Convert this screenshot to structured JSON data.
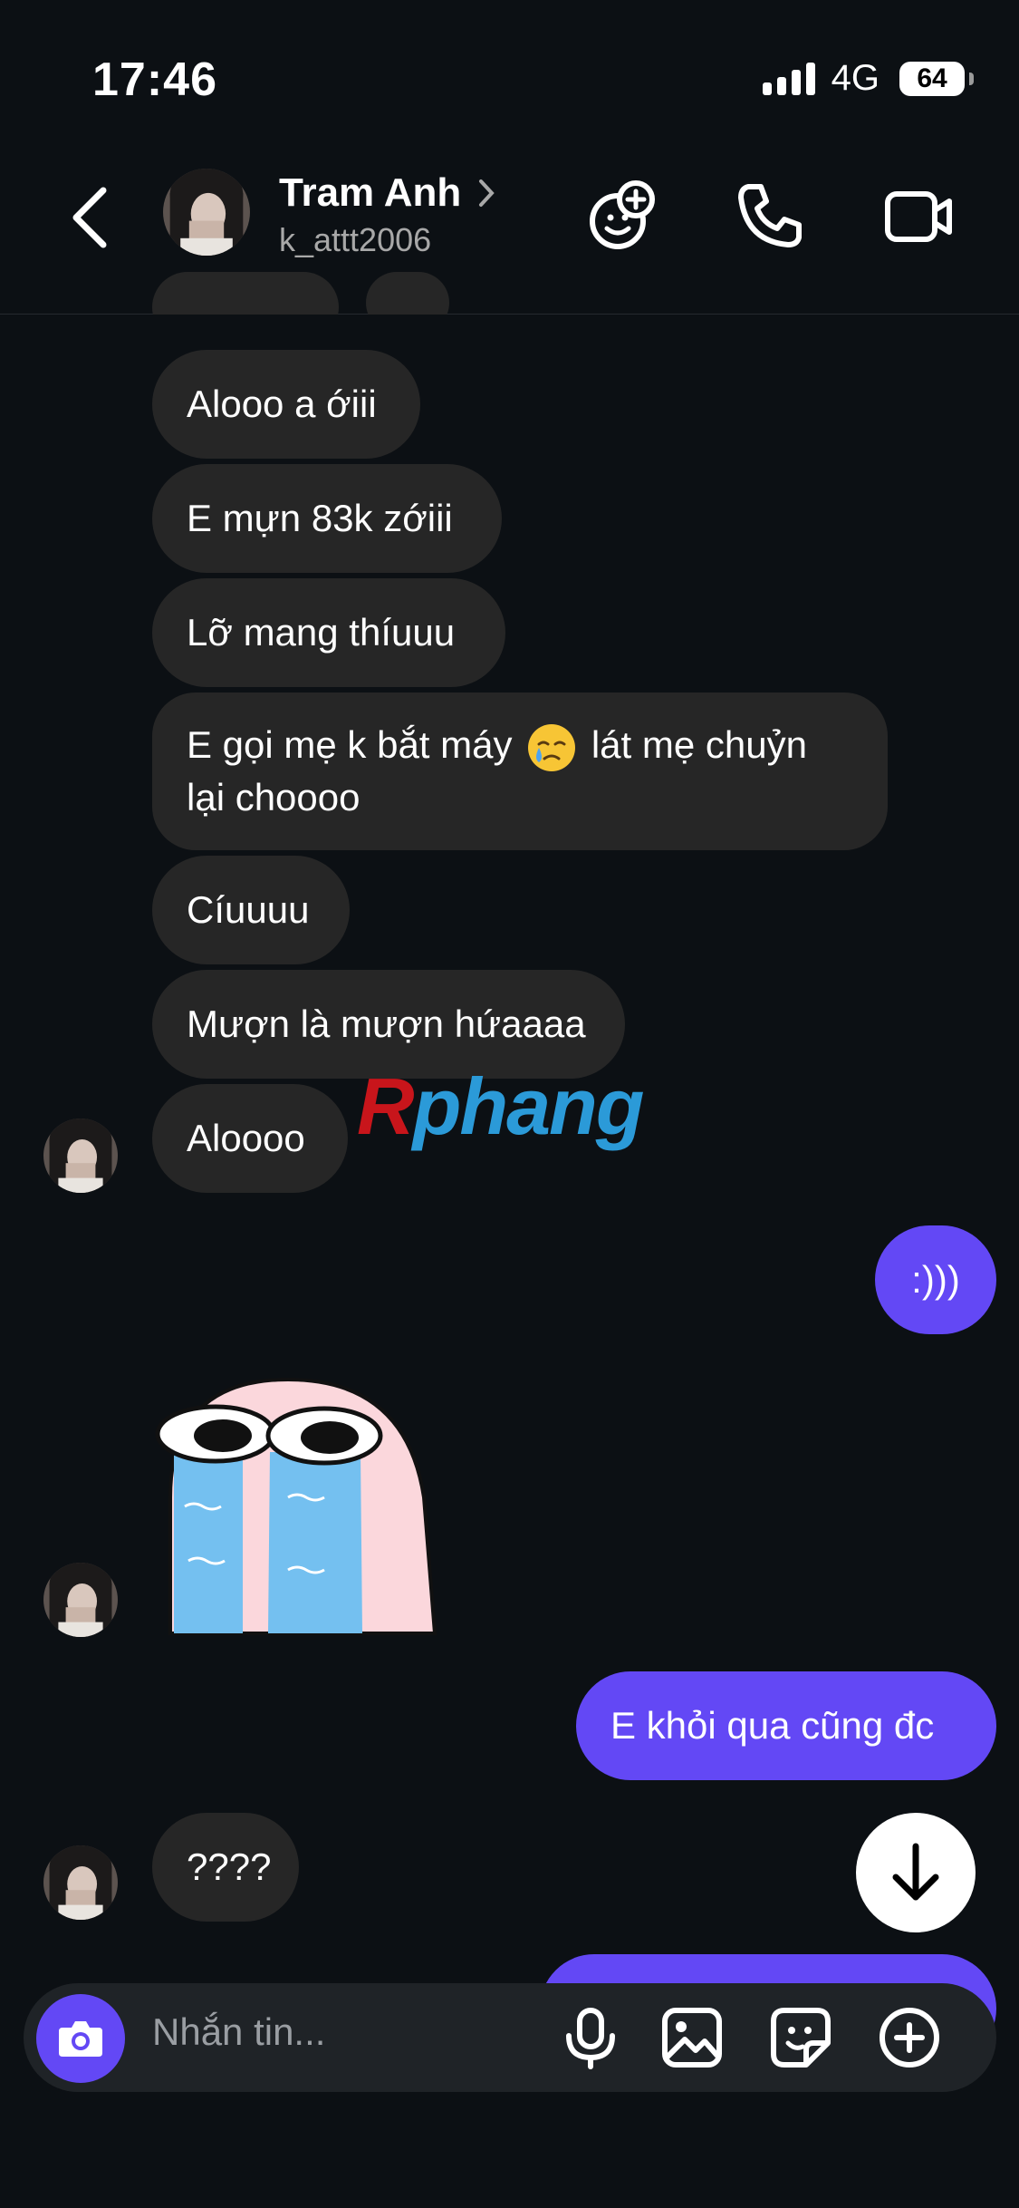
{
  "status_bar": {
    "time": "17:46",
    "network": "4G",
    "battery": "64"
  },
  "header": {
    "name": "Tram Anh",
    "username": "k_attt2006"
  },
  "messages": [
    {
      "text": "Alooo a ớiii",
      "direction": "in"
    },
    {
      "text": "E mựn 83k zớiii",
      "direction": "in"
    },
    {
      "text": "Lỡ mang thíuuu",
      "direction": "in"
    },
    {
      "text_line1_pre": "E gọi mẹ k bắt máy",
      "emoji": "crying-face",
      "text_line1_post": "lát mẹ chuỷn",
      "text_line2": "lại choooo",
      "direction": "in"
    },
    {
      "text": "Cíuuuu",
      "direction": "in"
    },
    {
      "text": "Mượn là mượn hứaaaa",
      "direction": "in"
    },
    {
      "text": "Aloooo",
      "direction": "in"
    },
    {
      "text": ":)))",
      "direction": "out"
    },
    {
      "sticker": "crying-ghost-sticker",
      "direction": "in"
    },
    {
      "text": "E khỏi qua cũng đc",
      "direction": "out"
    },
    {
      "text": "????",
      "direction": "in"
    }
  ],
  "watermark": {
    "first": "R",
    "rest": "phang"
  },
  "composer": {
    "placeholder": "Nhắn tin..."
  },
  "colors": {
    "background": "#0c1014",
    "incoming_bubble": "#262626",
    "outgoing_bubble": "#6348f5"
  }
}
